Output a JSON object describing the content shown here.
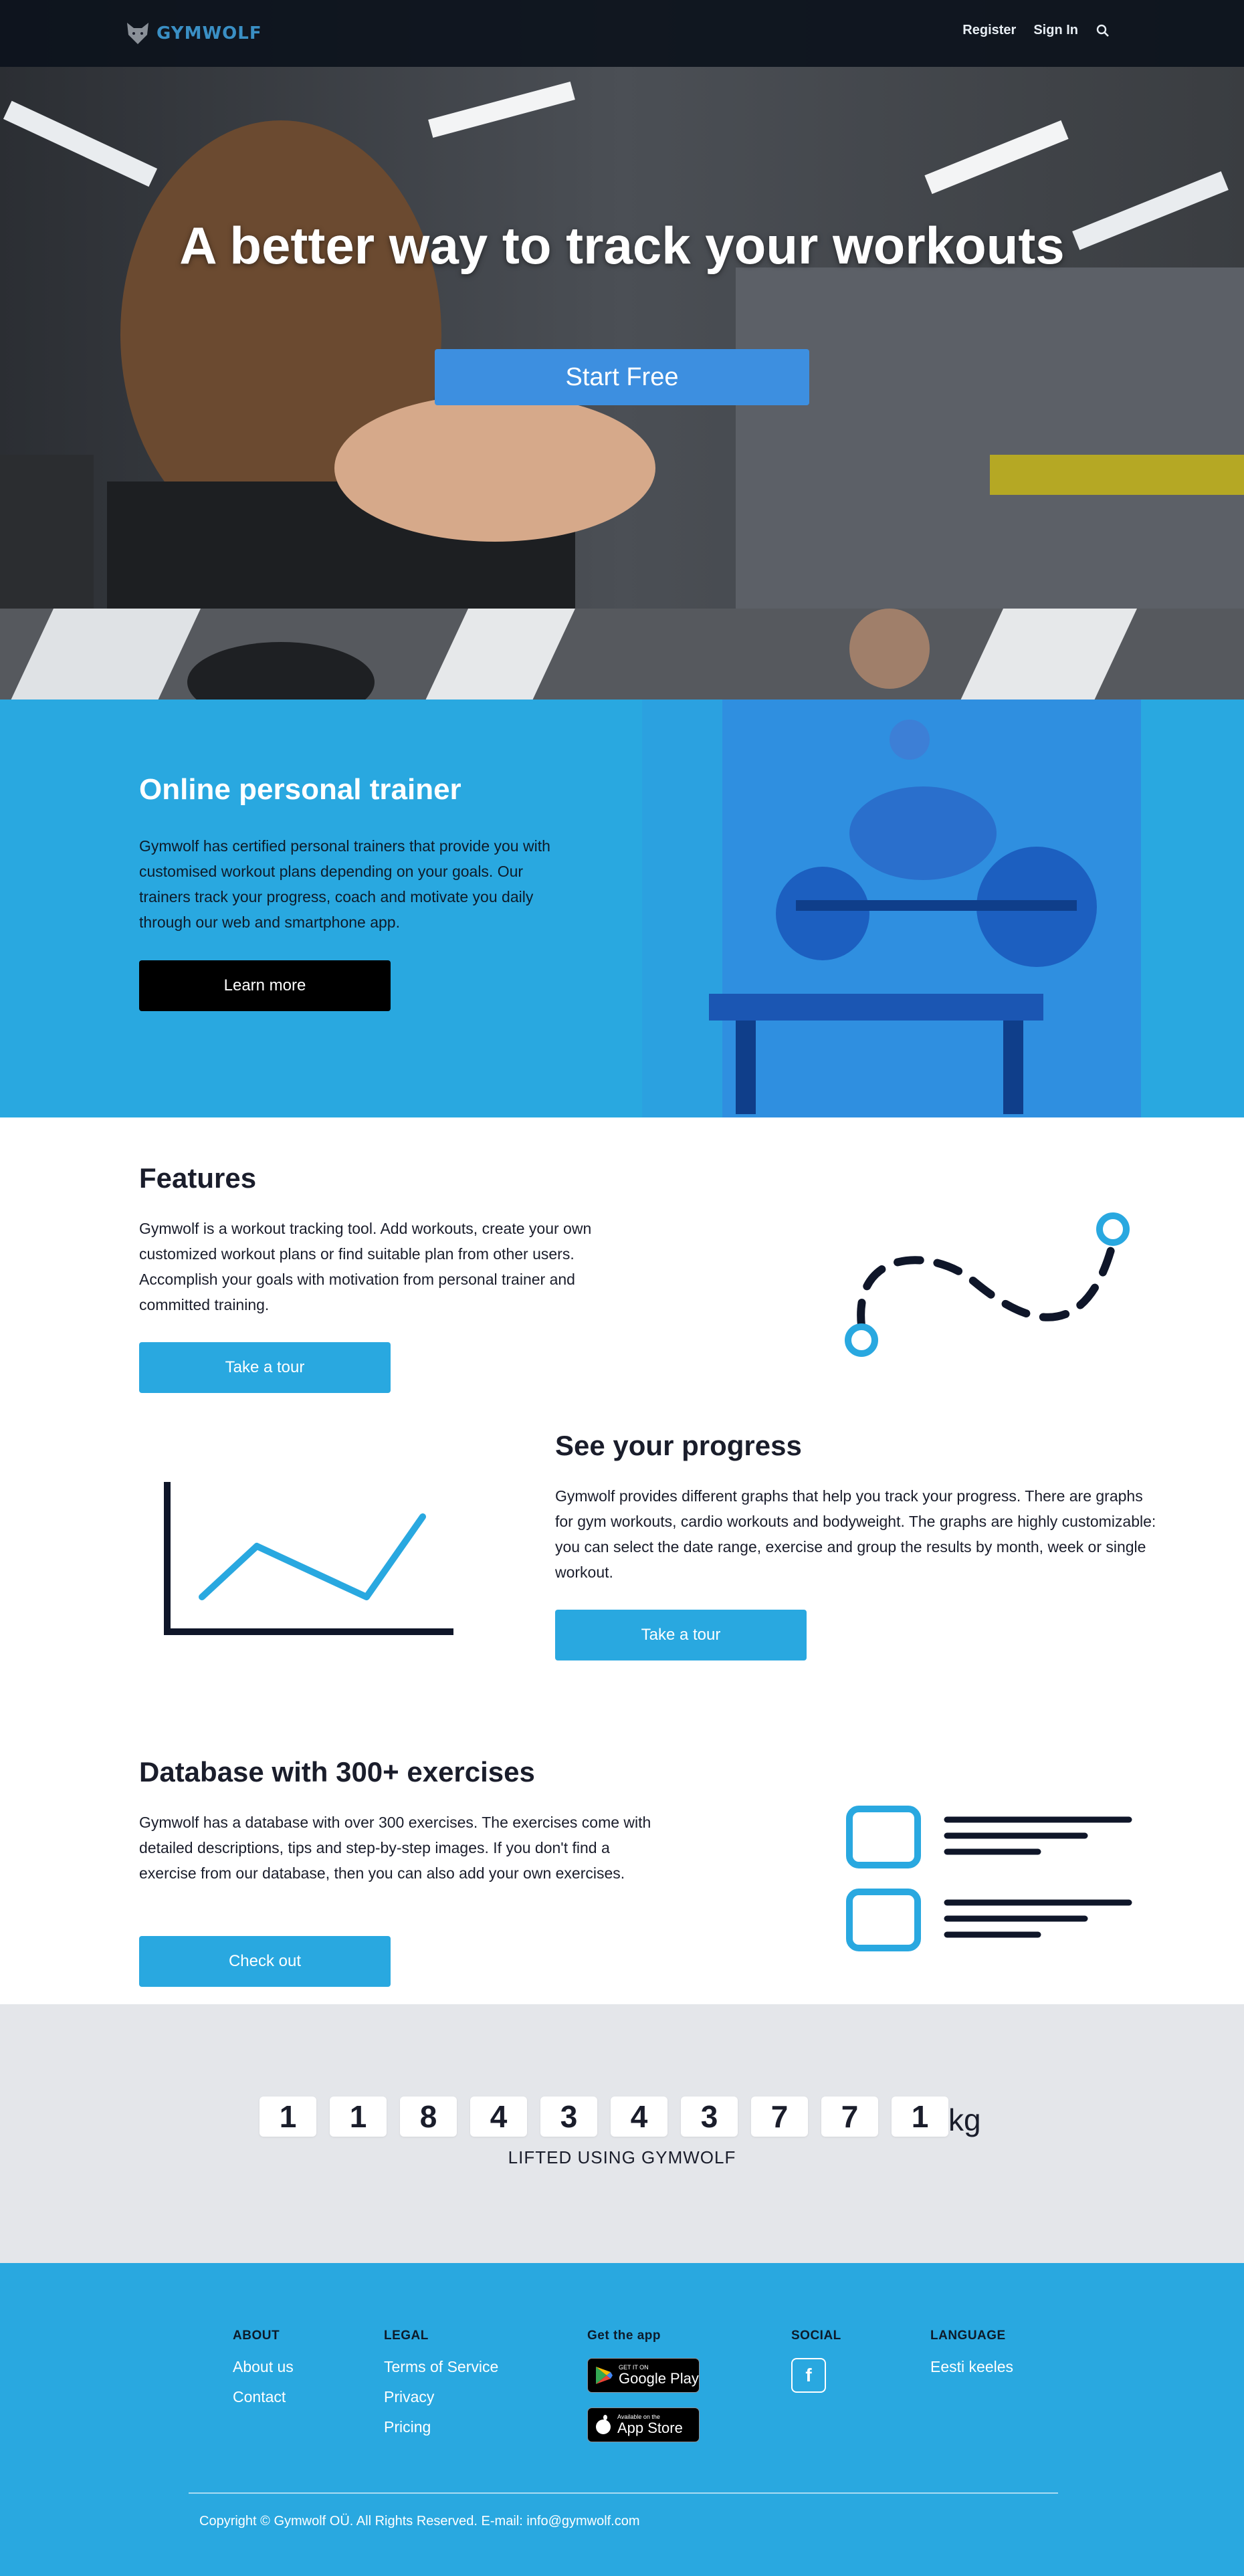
{
  "nav": {
    "logo_text": "GYMWOLF",
    "register_label": "Register",
    "signin_label": "Sign In",
    "search_icon": "search-icon"
  },
  "hero": {
    "title": "A better way to track your workouts",
    "cta_label": "Start Free"
  },
  "trainer": {
    "title": "Online personal trainer",
    "text": "Gymwolf has certified personal trainers that provide you with customised workout plans depending on your goals. Our trainers track your progress, coach and motivate you daily through our web and smartphone app.",
    "button_label": "Learn more"
  },
  "features": {
    "title": "Features",
    "text": "Gymwolf is a workout tracking tool. Add workouts, create your own customized workout plans or find suitable plan from other users. Accomplish your goals with motivation from personal trainer and committed training.",
    "button_label": "Take a tour"
  },
  "progress": {
    "title": "See your progress",
    "text": "Gymwolf provides different graphs that help you track your progress. There are graphs for gym workouts, cardio workouts and bodyweight. The graphs are highly customizable: you can select the date range, exercise and group the results by month, week or single workout.",
    "button_label": "Take a tour"
  },
  "database": {
    "title": "Database with 300+ exercises",
    "text": "Gymwolf has a database with over 300 exercises. The exercises come with detailed descriptions, tips and step-by-step images. If you don't find a exercise from our database, then you can also add your own exercises.",
    "button_label": "Check out"
  },
  "counter": {
    "digits": [
      "1",
      "1",
      "8",
      "4",
      "3",
      "4",
      "3",
      "7",
      "7",
      "1"
    ],
    "unit": "kg",
    "label": "LIFTED USING GYMWOLF"
  },
  "footer": {
    "about": {
      "heading": "ABOUT",
      "links": [
        "About us",
        "Contact"
      ]
    },
    "legal": {
      "heading": "LEGAL",
      "links": [
        "Terms of Service",
        "Privacy",
        "Pricing"
      ]
    },
    "app": {
      "heading": "Get the app",
      "google_small": "GET IT ON",
      "google_big": "Google Play",
      "apple_small": "Available on the",
      "apple_big": "App Store"
    },
    "social": {
      "heading": "SOCIAL",
      "facebook_glyph": "f"
    },
    "language": {
      "heading": "LANGUAGE",
      "link": "Eesti keeles"
    },
    "copyright": "Copyright © Gymwolf OÜ. All Rights Reserved. E-mail: info@gymwolf.com"
  },
  "colors": {
    "brand_blue": "#29a8e0",
    "button_blue": "#3d8fe0",
    "nav_bg": "#0c121c",
    "counter_bg": "#e4e6ea",
    "dark": "#1a1d2b"
  }
}
